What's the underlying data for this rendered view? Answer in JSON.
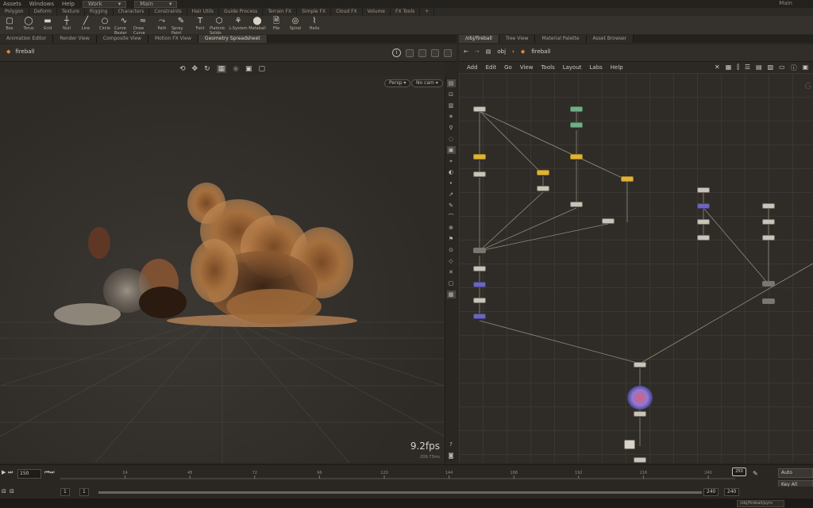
{
  "menubar": {
    "items": [
      "Assets",
      "Windows",
      "Help"
    ],
    "desktop": "Work",
    "desktop2": "Main",
    "user": "Main"
  },
  "shelf_tabs": [
    "Polygon",
    "Deform",
    "Texture",
    "Rigging",
    "Characters",
    "Constraints",
    "Hair Utils",
    "Guide Process",
    "Terrain FX",
    "Simple FX",
    "Cloud FX",
    "Volume",
    "FX Tools"
  ],
  "tools": [
    {
      "label": "Box",
      "icon": "box-icon"
    },
    {
      "label": "Torus",
      "icon": "torus-icon"
    },
    {
      "label": "Grid",
      "icon": "grid-icon"
    },
    {
      "label": "Null",
      "icon": "null-icon"
    },
    {
      "label": "Line",
      "icon": "line-icon"
    },
    {
      "label": "Circle",
      "icon": "circle-icon"
    },
    {
      "label": "Curve Bezier",
      "icon": "curve-icon"
    },
    {
      "label": "Draw Curve",
      "icon": "draw-curve-icon"
    },
    {
      "label": "Path",
      "icon": "path-icon"
    },
    {
      "label": "Spray Paint",
      "icon": "spray-icon"
    },
    {
      "label": "Font",
      "icon": "font-icon"
    },
    {
      "label": "Platonic Solids",
      "icon": "platonic-icon"
    },
    {
      "label": "L-System",
      "icon": "lsystem-icon"
    },
    {
      "label": "Metaball",
      "icon": "metaball-icon"
    },
    {
      "label": "File",
      "icon": "file-icon"
    },
    {
      "label": "Spiral",
      "icon": "spiral-icon"
    },
    {
      "label": "Helix",
      "icon": "helix-icon"
    }
  ],
  "left_tabs": [
    "Animation Editor",
    "Render View",
    "Composite View",
    "Motion FX View",
    "Geometry Spreadsheet"
  ],
  "right_tabs": [
    "/obj/fireball",
    "Tree View",
    "Material Palette",
    "Asset Browser"
  ],
  "viewport": {
    "path": "fireball",
    "camera_menu": "Persp",
    "cam_menu": "No cam",
    "fps": "9.2fps",
    "fps_sub": "209.73ms"
  },
  "network": {
    "path_obj": "obj",
    "path_node": "fireball",
    "menus": [
      "Add",
      "Edit",
      "Go",
      "View",
      "Tools",
      "Layout",
      "Labs",
      "Help"
    ],
    "watermark": "G"
  },
  "timeline": {
    "current_frame": "150",
    "end_frame": "250",
    "ticks": [
      "24",
      "48",
      "72",
      "96",
      "120",
      "144",
      "168",
      "192",
      "216",
      "240"
    ],
    "range_start": "1",
    "range_start2": "1",
    "range_end": "240",
    "range_end2": "240",
    "status_field": "/obj/fireball/pyro",
    "btn1": "Auto",
    "btn2": "Key All"
  }
}
